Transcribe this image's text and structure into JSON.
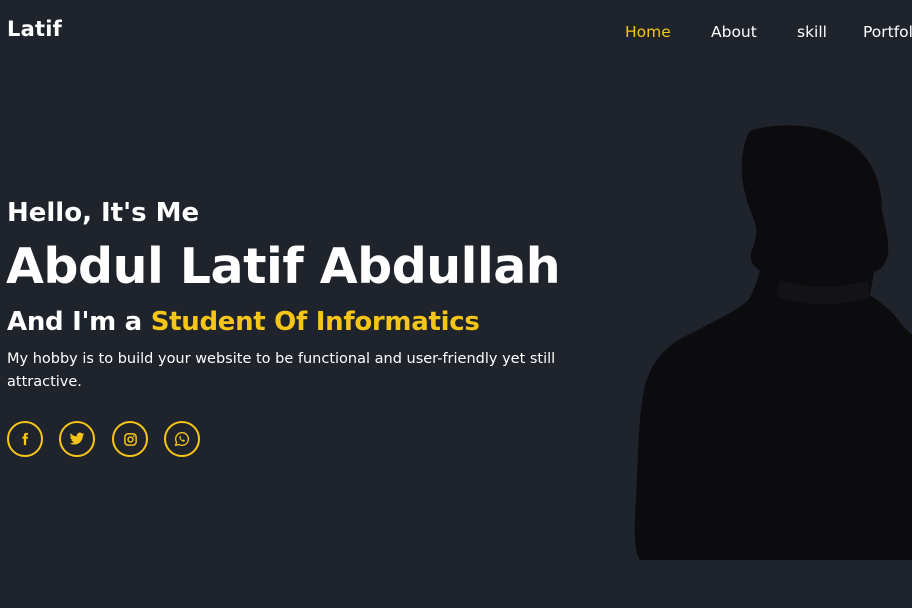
{
  "header": {
    "logo": "Latif",
    "nav": [
      {
        "label": "Home",
        "active": true
      },
      {
        "label": "About",
        "active": false
      },
      {
        "label": "skill",
        "active": false
      },
      {
        "label": "Portfol",
        "active": false
      }
    ]
  },
  "hero": {
    "greeting": "Hello, It's Me",
    "name": "Abdul Latif Abdullah",
    "role_prefix": "And I'm a",
    "role_highlight": "Student Of Informatics",
    "description": "My hobby is to build your website to be functional and user-friendly yet still attractive.",
    "socials": [
      {
        "icon": "facebook-icon"
      },
      {
        "icon": "twitter-icon"
      },
      {
        "icon": "instagram-icon"
      },
      {
        "icon": "whatsapp-icon"
      }
    ]
  },
  "colors": {
    "background": "#1f232b",
    "accent": "#f5c518",
    "text": "#ffffff"
  }
}
